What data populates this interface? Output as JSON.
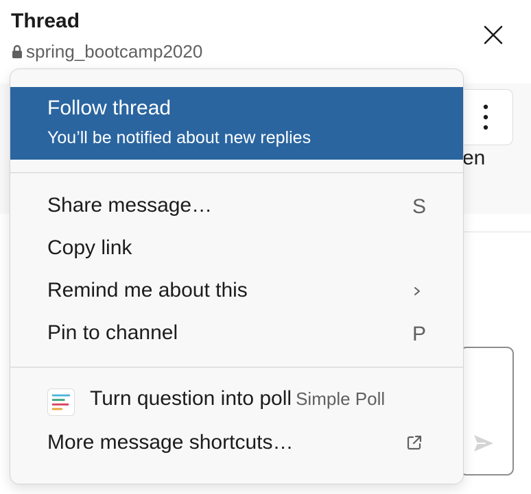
{
  "header": {
    "title": "Thread",
    "channel": "spring_bootcamp2020"
  },
  "background": {
    "ghost_text": "en"
  },
  "menu": {
    "follow": {
      "title": "Follow thread",
      "subtitle": "You’ll be notified about new replies"
    },
    "items": [
      {
        "label": "Share message…",
        "shortcut": "S"
      },
      {
        "label": "Copy link",
        "shortcut": ""
      },
      {
        "label": "Remind me about this",
        "shortcut": "",
        "submenu": true
      },
      {
        "label": "Pin to channel",
        "shortcut": "P"
      }
    ],
    "poll": {
      "label": "Turn question into poll",
      "app": "Simple Poll"
    },
    "more": {
      "label": "More message shortcuts…"
    }
  },
  "colors": {
    "highlight": "#2a65a0",
    "menu_bg": "#f8f8f8"
  },
  "icons": {
    "close": "close-icon",
    "lock": "lock-icon",
    "more": "vertical-dots-icon",
    "submenu": "chevron-right-icon",
    "poll": "simple-poll-icon",
    "external": "external-link-icon",
    "send": "send-icon"
  }
}
